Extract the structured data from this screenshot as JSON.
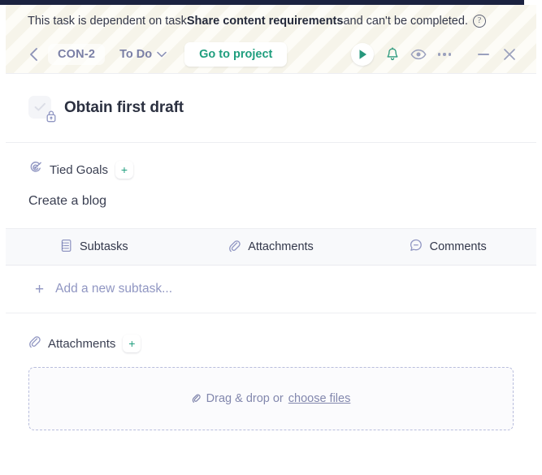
{
  "banner": {
    "text_before": "This task is dependent on task ",
    "dependency_task": "Share content requirements",
    "text_after": " and can't be completed.",
    "help_icon": "question-circle-icon"
  },
  "toolbar": {
    "back_icon": "chevron-left-icon",
    "task_key": "CON-2",
    "status": "To Do",
    "status_chevron_icon": "chevron-down-icon",
    "goto_project": "Go to project",
    "play_icon": "play-icon",
    "bell_icon": "bell-icon",
    "eye_icon": "eye-icon",
    "more_icon": "ellipsis-icon",
    "minimize_icon": "minimize-icon",
    "close_icon": "close-icon"
  },
  "task": {
    "checkbox_icon": "checkmark-icon",
    "lock_icon": "lock-icon",
    "title": "Obtain first draft"
  },
  "goals": {
    "icon": "goal-target-icon",
    "label": "Tied Goals",
    "add_label": "+",
    "items": [
      {
        "name": "Create a blog"
      }
    ]
  },
  "tabs": [
    {
      "label": "Subtasks",
      "icon": "subtask-list-icon"
    },
    {
      "label": "Attachments",
      "icon": "paperclip-icon"
    },
    {
      "label": "Comments",
      "icon": "comment-bubble-icon"
    }
  ],
  "subtasks": {
    "add_plus": "+",
    "add_placeholder": "Add a new subtask..."
  },
  "attachments": {
    "icon": "paperclip-icon",
    "label": "Attachments",
    "add_label": "+",
    "dropzone": {
      "clip_icon": "paperclip-icon",
      "text": "Drag & drop or",
      "link": "choose files"
    }
  },
  "colors": {
    "accent_green": "#1f9e7e",
    "muted_purple": "#7a7fa6",
    "text_dark": "#2b3040",
    "stripe_light": "#fdfcf7",
    "stripe_dark": "#f6f4ea",
    "navy_strip": "#1b2240"
  }
}
